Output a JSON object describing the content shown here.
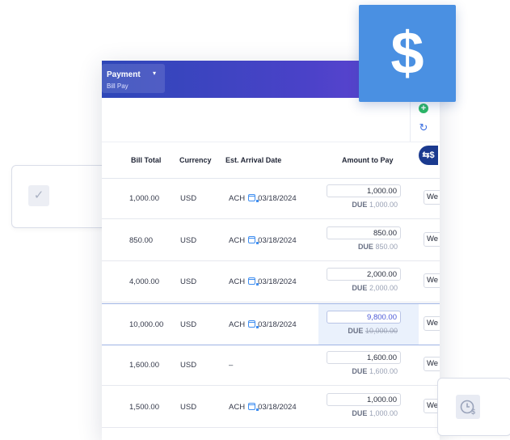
{
  "header": {
    "tab_title": "Payment",
    "tab_caret": "▾",
    "tab_subtitle": "Bill Pay"
  },
  "toolbar": {
    "add_icon": "plus-circle-icon",
    "refresh_icon": "refresh-icon",
    "flow_icon": "money-flow-icon"
  },
  "columns": {
    "bill_total": "Bill Total",
    "currency": "Currency",
    "arrival": "Est. Arrival Date",
    "amount": "Amount to Pay"
  },
  "due_label": "DUE",
  "rows": [
    {
      "bill_total": "1,000.00",
      "currency": "USD",
      "method": "ACH",
      "date": "03/18/2024",
      "amount": "1,000.00",
      "due": "1,000.00",
      "method_box": "We"
    },
    {
      "bill_total": "850.00",
      "currency": "USD",
      "method": "ACH",
      "date": "03/18/2024",
      "amount": "850.00",
      "due": "850.00",
      "method_box": "We"
    },
    {
      "bill_total": "4,000.00",
      "currency": "USD",
      "method": "ACH",
      "date": "03/18/2024",
      "amount": "2,000.00",
      "due": "2,000.00",
      "method_box": "We"
    },
    {
      "bill_total": "10,000.00",
      "currency": "USD",
      "method": "ACH",
      "date": "03/18/2024",
      "amount": "9,800.00",
      "due": "10,000.00",
      "method_box": "We",
      "selected": true
    },
    {
      "bill_total": "1,600.00",
      "currency": "USD",
      "method": "–",
      "date": "",
      "amount": "1,600.00",
      "due": "1,600.00",
      "method_box": "We"
    },
    {
      "bill_total": "1,500.00",
      "currency": "USD",
      "method": "ACH",
      "date": "03/18/2024",
      "amount": "1,000.00",
      "due": "1,000.00",
      "method_box": "We"
    }
  ],
  "decor": {
    "dollar_symbol": "$",
    "dollar_tile_color": "#4a90e2",
    "check_icon": "checkmark-icon",
    "clock_icon": "clock-dollar-icon"
  },
  "colors": {
    "topbar_start": "#2e47b8",
    "topbar_end": "#6a46d6",
    "selected_row_bg": "#eaf1fc",
    "accent_amount": "#4a58d6"
  }
}
